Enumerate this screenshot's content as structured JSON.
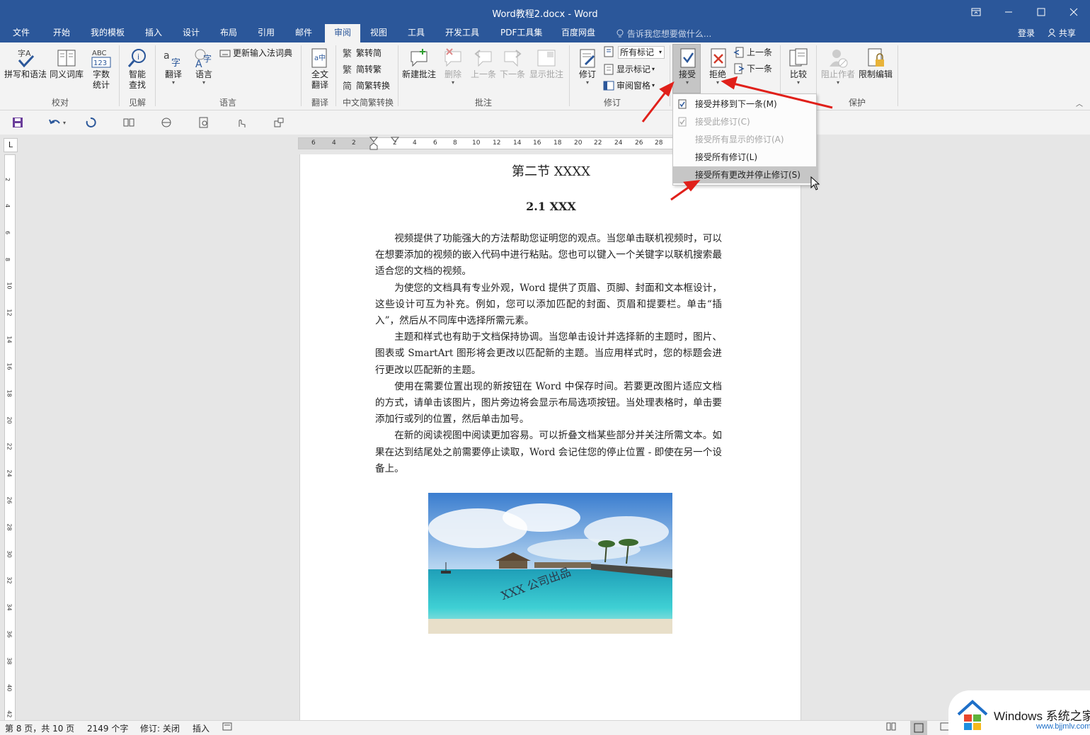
{
  "window": {
    "title": "Word教程2.docx - Word"
  },
  "tabs": [
    "文件",
    "开始",
    "我的模板",
    "插入",
    "设计",
    "布局",
    "引用",
    "邮件",
    "审阅",
    "视图",
    "工具",
    "开发工具",
    "PDF工具集",
    "百度网盘"
  ],
  "active_tab": "审阅",
  "tell_me": "告诉我您想要做什么...",
  "account": {
    "login": "登录",
    "share": "共享"
  },
  "ribbon": {
    "spelling": "拼写和语法",
    "thesaurus": "同义词库",
    "wordcount": [
      "字数",
      "统计"
    ],
    "smart_lookup": [
      "智能",
      "查找"
    ],
    "translate": "翻译",
    "language": "语言",
    "update_ime": "更新输入法词典",
    "full_translate": [
      "全文",
      "翻译"
    ],
    "trad_to_simp": "繁转简",
    "simp_to_trad": "简转繁",
    "conv_trad": "简繁转换",
    "new_comment": "新建批注",
    "delete": "删除",
    "prev_comment": "上一条",
    "next_comment": "下一条",
    "show_comments": "显示批注",
    "track": "修订",
    "markup_select": "所有标记",
    "show_markup": "显示标记",
    "review_pane": "审阅窗格",
    "accept": "接受",
    "reject": "拒绝",
    "prev_change": "上一条",
    "next_change": "下一条",
    "compare": "比较",
    "block_authors": "阻止作者",
    "restrict_editing": "限制编辑",
    "groups": [
      "校对",
      "见解",
      "语言",
      "翻译",
      "中文简繁转换",
      "批注",
      "修订",
      "保护"
    ]
  },
  "accept_menu": [
    {
      "label": "接受并移到下一条(M)",
      "enabled": true
    },
    {
      "label": "接受此修订(C)",
      "enabled": false
    },
    {
      "label": "接受所有显示的修订(A)",
      "enabled": false
    },
    {
      "label": "接受所有修订(L)",
      "enabled": true
    },
    {
      "label": "接受所有更改并停止修订(S)",
      "enabled": true,
      "highlighted": true
    }
  ],
  "ruler": {
    "h": [
      "6",
      "4",
      "2",
      "2",
      "4",
      "6",
      "8",
      "10",
      "12",
      "14",
      "16",
      "18",
      "20",
      "22",
      "24",
      "26",
      "28"
    ],
    "v": [
      "2",
      "4",
      "6",
      "8",
      "10",
      "12",
      "14",
      "16",
      "18",
      "20",
      "22",
      "24",
      "26",
      "28",
      "30",
      "32",
      "34",
      "36",
      "38",
      "40",
      "42"
    ]
  },
  "document": {
    "heading1": "第二节 XXXX",
    "heading2": "2.1 XXX",
    "paragraphs": [
      "视频提供了功能强大的方法帮助您证明您的观点。当您单击联机视频时，可以在想要添加的视频的嵌入代码中进行粘贴。您也可以键入一个关键字以联机搜索最适合您的文档的视频。",
      "为使您的文档具有专业外观，Word 提供了页眉、页脚、封面和文本框设计，这些设计可互为补充。例如，您可以添加匹配的封面、页眉和提要栏。单击“插入”，然后从不同库中选择所需元素。",
      "主题和样式也有助于文档保持协调。当您单击设计并选择新的主题时，图片、图表或 SmartArt 图形将会更改以匹配新的主题。当应用样式时，您的标题会进行更改以匹配新的主题。",
      "使用在需要位置出现的新按钮在 Word 中保存时间。若要更改图片适应文档的方式，请单击该图片，图片旁边将会显示布局选项按钮。当处理表格时，单击要添加行或列的位置，然后单击加号。",
      "在新的阅读视图中阅读更加容易。可以折叠文档某些部分并关注所需文本。如果在达到结尾处之前需要停止读取，Word 会记住您的停止位置 - 即使在另一个设备上。"
    ],
    "image_watermark": "XXX 公司出品"
  },
  "status": {
    "page": "第 8 页，共 10 页",
    "words": "2149 个字",
    "track": "修订: 关闭",
    "insert": "插入"
  },
  "watermark_logo": {
    "brand": "Windows 系统之家",
    "url": "www.bjjmlv.com"
  }
}
